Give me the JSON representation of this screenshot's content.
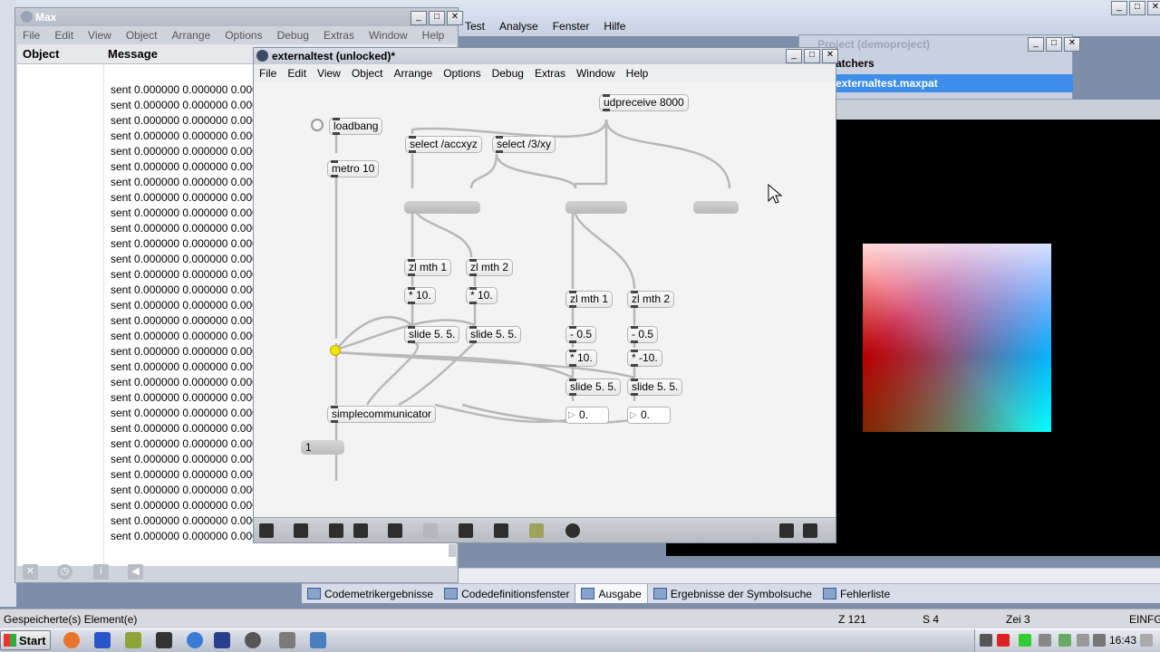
{
  "ide": {
    "menu": [
      "Test",
      "Analyse",
      "Fenster",
      "Hilfe"
    ],
    "bottom_tabs": [
      {
        "label": "Codemetrikergebnisse",
        "active": false
      },
      {
        "label": "Codedefinitionsfenster",
        "active": false
      },
      {
        "label": "Ausgabe",
        "active": true
      },
      {
        "label": "Ergebnisse der Symbolsuche",
        "active": false
      },
      {
        "label": "Fehlerliste",
        "active": false
      }
    ],
    "status": {
      "message": "Gespeicherte(s) Element(e)",
      "line": "Z 121",
      "col": "S 4",
      "char": "Zei 3",
      "mode": "EINFG"
    }
  },
  "taskbar": {
    "start_label": "Start",
    "clock": "16:43"
  },
  "project_window": {
    "title": "Project (demoproject)",
    "section": "atchers",
    "selected_item": "externaltest.maxpat"
  },
  "max_console": {
    "title": "Max",
    "menu": [
      "File",
      "Edit",
      "View",
      "Object",
      "Arrange",
      "Options",
      "Debug",
      "Extras",
      "Window",
      "Help"
    ],
    "col_object": "Object",
    "col_message": "Message",
    "row_text": "sent 0.000000 0.000000 0.000000 0.000000",
    "row_count": 30
  },
  "patcher": {
    "title": "externaltest (unlocked)*",
    "menu": [
      "File",
      "Edit",
      "View",
      "Object",
      "Arrange",
      "Options",
      "Debug",
      "Extras",
      "Window",
      "Help"
    ],
    "objects": {
      "udpreceive": "udpreceive 8000",
      "loadbang": "loadbang",
      "metro": "metro 10",
      "select_accxyz": "select /accxyz",
      "select_3xy": "select /3/xy",
      "zl1a": "zl mth 1",
      "zl2a": "zl mth 2",
      "mul1a": "* 10.",
      "mul2a": "* 10.",
      "slide1a": "slide 5. 5.",
      "slide2a": "slide 5. 5.",
      "zl1b": "zl mth 1",
      "zl2b": "zl mth 2",
      "sub1": "- 0.5",
      "sub2": "- 0.5",
      "mul1b": "* 10.",
      "mul2b": "* -10.",
      "slide1b": "slide 5. 5.",
      "slide2b": "slide 5. 5.",
      "num1": "0.",
      "num2": "0.",
      "simplecomm": "simplecommunicator",
      "msg1": "1"
    }
  },
  "colors": {
    "selection_blue": "#3d8ee8",
    "patch_bg": "#f3f3f3",
    "cord_gray": "#b8b8b8",
    "toggle_yellow": "#f3e600"
  }
}
